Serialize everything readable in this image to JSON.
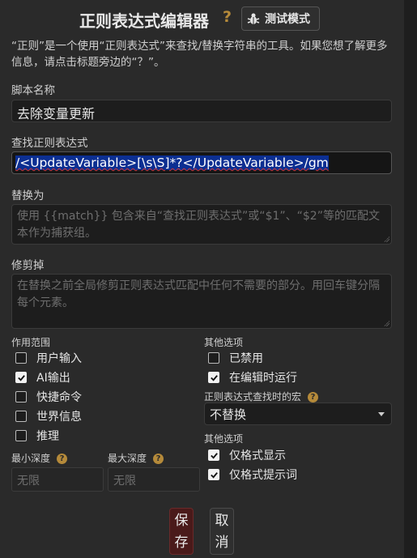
{
  "header": {
    "title": "正则表达式编辑器",
    "help": "?",
    "test_button": "测试模式"
  },
  "description": "“正则”是一个使用“正则表达式”来查找/替换字符串的工具。如果您想了解更多信息，请点击标题旁边的“？”。",
  "script_name": {
    "label": "脚本名称",
    "value": "去除变量更新"
  },
  "find_regex": {
    "label": "查找正则表达式",
    "value": "/<UpdateVariable>[\\s\\S]*?</UpdateVariable>/gm"
  },
  "replace_with": {
    "label": "替换为",
    "placeholder": "使用 {{match}} 包含来自“查找正则表达式”或“$1”、“$2”等的匹配文本作为捕获组。"
  },
  "trim_out": {
    "label": "修剪掉",
    "placeholder": "在替换之前全局修剪正则表达式匹配中任何不需要的部分。用回车键分隔每个元素。"
  },
  "scope": {
    "label": "作用范围",
    "items": [
      {
        "label": "用户输入",
        "checked": false
      },
      {
        "label": "AI输出",
        "checked": true
      },
      {
        "label": "快捷命令",
        "checked": false
      },
      {
        "label": "世界信息",
        "checked": false
      },
      {
        "label": "推理",
        "checked": false
      }
    ]
  },
  "other_options": {
    "label": "其他选项",
    "items": [
      {
        "label": "已禁用",
        "checked": false
      },
      {
        "label": "在编辑时运行",
        "checked": true
      }
    ]
  },
  "macro": {
    "label": "正则表达式查找时的宏",
    "value": "不替换",
    "help": "?"
  },
  "other_options2": {
    "label": "其他选项",
    "items": [
      {
        "label": "仅格式显示",
        "checked": true
      },
      {
        "label": "仅格式提示词",
        "checked": true
      }
    ]
  },
  "min_depth": {
    "label": "最小深度",
    "placeholder": "无限",
    "help": "?"
  },
  "max_depth": {
    "label": "最大深度",
    "placeholder": "无限",
    "help": "?"
  },
  "buttons": {
    "save_line1": "保",
    "save_line2": "存",
    "cancel_line1": "取",
    "cancel_line2": "消"
  },
  "colors": {
    "accent": "#b58a3a",
    "selection": "#0c2f92",
    "save_bg": "#4a1a1a"
  }
}
